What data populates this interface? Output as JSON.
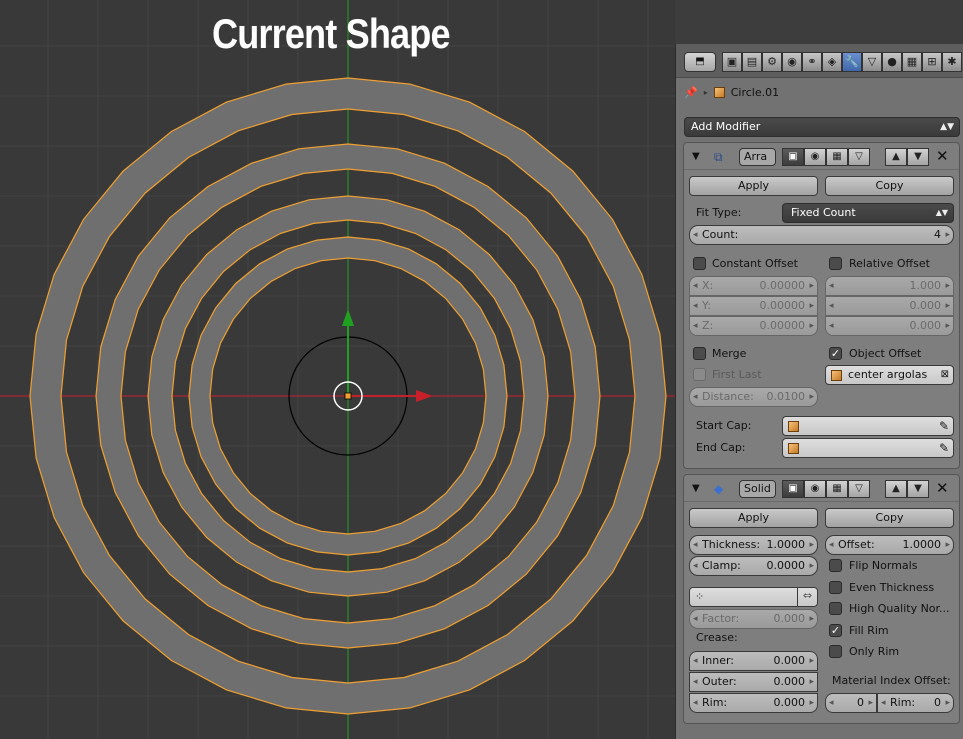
{
  "title": "Current Shape",
  "viewport": {
    "colors": {
      "background": "#393939",
      "ring_fill": "#6f6f6f",
      "ring_edge": "#f0a030",
      "x_axis": "#c8202a",
      "y_axis": "#20a020"
    }
  },
  "panel": {
    "editor_icon": "⬒",
    "tabs": [
      "▣",
      "▤",
      "⚙",
      "◉",
      "⚭",
      "◈",
      "🔧",
      "▽",
      "●",
      "▦",
      "⊞",
      "✱"
    ],
    "active_tab_index": 6,
    "context": {
      "pin_icon": "📌",
      "object_name": "Circle.01"
    },
    "add_modifier": "Add Modifier",
    "array": {
      "name": "Arra",
      "apply": "Apply",
      "copy": "Copy",
      "fit_type_label": "Fit Type:",
      "fit_type_value": "Fixed Count",
      "count_label": "Count:",
      "count_value": "4",
      "constant_offset": "Constant Offset",
      "relative_offset": "Relative Offset",
      "x_label": "X:",
      "x_value": "0.00000",
      "y_label": "Y:",
      "y_value": "0.00000",
      "z_label": "Z:",
      "z_value": "0.00000",
      "rel_x": "1.000",
      "rel_y": "0.000",
      "rel_z": "0.000",
      "merge": "Merge",
      "object_offset": "Object Offset",
      "object_offset_checked": true,
      "first_last": "First Last",
      "offset_object": "center argolas",
      "distance_label": "Distance:",
      "distance_value": "0.0100",
      "start_cap": "Start Cap:",
      "end_cap": "End Cap:"
    },
    "solid": {
      "name": "Solid",
      "apply": "Apply",
      "copy": "Copy",
      "thickness_label": "Thickness:",
      "thickness_value": "1.0000",
      "offset_label": "Offset:",
      "offset_value": "1.0000",
      "clamp_label": "Clamp:",
      "clamp_value": "0.0000",
      "flip_normals": "Flip Normals",
      "even_thickness": "Even Thickness",
      "high_quality": "High Quality Nor...",
      "fill_rim": "Fill Rim",
      "fill_rim_checked": true,
      "only_rim": "Only Rim",
      "factor_label": "Factor:",
      "factor_value": "0.000",
      "crease_label": "Crease:",
      "inner_label": "Inner:",
      "inner_value": "0.000",
      "outer_label": "Outer:",
      "outer_value": "0.000",
      "rim_label": "Rim:",
      "rim_value": "0.000",
      "material_index_label": "Material Index Offset:",
      "mat_value": "0",
      "mat_rim_label": "Rim:",
      "mat_rim_value": "0"
    }
  }
}
